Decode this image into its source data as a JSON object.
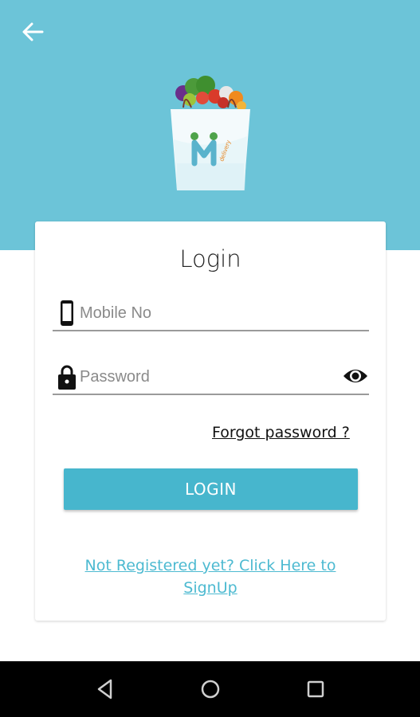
{
  "header": {
    "back_icon": "arrow-left-icon",
    "logo": {
      "icon": "shopping-bag-logo",
      "brand_letter": "M",
      "brand_text": "Mdelivery"
    }
  },
  "login_card": {
    "title": "Login",
    "mobile": {
      "icon": "smartphone-icon",
      "placeholder": "Mobile No",
      "value": ""
    },
    "password": {
      "icon": "lock-icon",
      "placeholder": "Password",
      "value": "",
      "toggle_icon": "eye-icon"
    },
    "forgot_label": "Forgot password ?",
    "login_label": "LOGIN",
    "signup_line1": "Not Registered yet? Click Here to",
    "signup_line2": "SignUp"
  },
  "nav_bar": {
    "back_icon": "triangle-back-icon",
    "home_icon": "circle-home-icon",
    "recents_icon": "square-recents-icon"
  },
  "colors": {
    "header_bg": "#6cc4d8",
    "button_bg": "#47b6cd",
    "link": "#4dbad1"
  }
}
